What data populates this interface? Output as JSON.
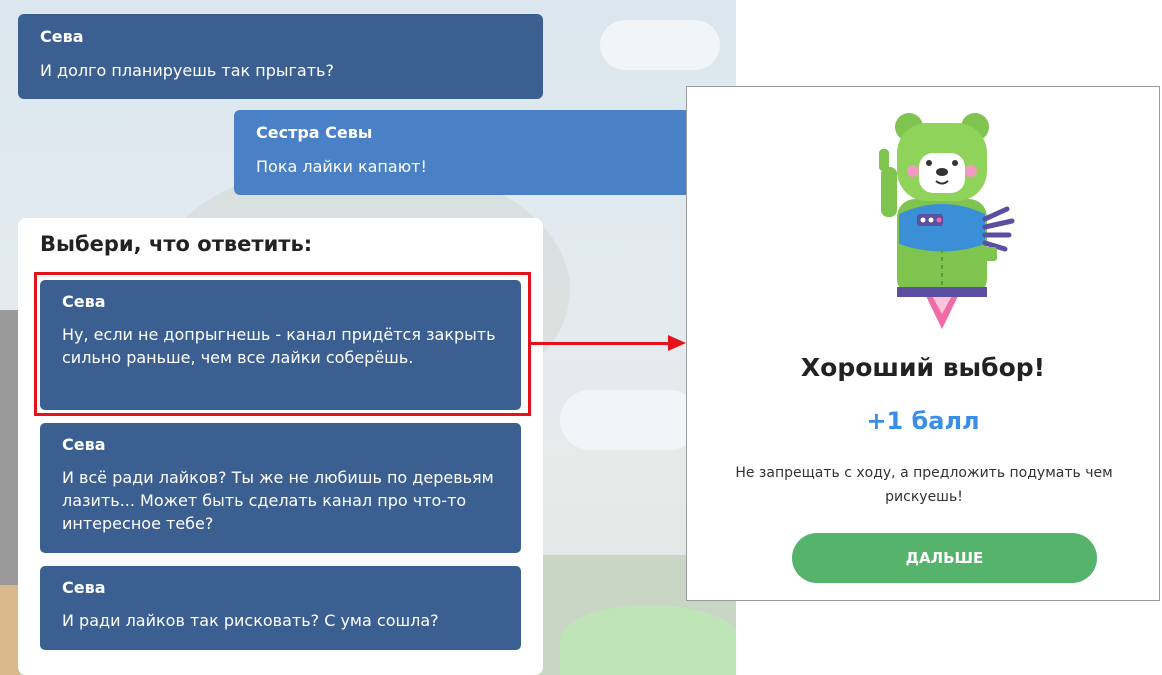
{
  "chat": {
    "messages": [
      {
        "name": "Сева",
        "text": "И долго планируешь так прыгать?"
      },
      {
        "name": "Сестра Севы",
        "text": "Пока лайки капают!"
      }
    ]
  },
  "choices": {
    "title": "Выбери, что ответить:",
    "options": [
      {
        "name": "Сева",
        "text": "Ну, если не допрыгнешь - канал придётся закрыть сильно раньше, чем все лайки соберёшь."
      },
      {
        "name": "Сева",
        "text": "И всё ради лайков? Ты же не любишь по деревьям лазить... Может быть сделать канал про что-то интересное тебе?"
      },
      {
        "name": "Сева",
        "text": "И ради лайков так рисковать? С ума сошла?"
      }
    ]
  },
  "result": {
    "title": "Хороший выбор!",
    "points": "+1 балл",
    "description": "Не запрещать с ходу, а предложить подумать чем рискуешь!",
    "button_label": "ДАЛЬШЕ",
    "mascot_icon": "bear-mascot-icon"
  },
  "colors": {
    "choice_bg": "#3c5f91",
    "sister_bg": "#4a80c6",
    "highlight": "#e3121b",
    "button": "#56b36c",
    "points": "#3b8ee6"
  }
}
